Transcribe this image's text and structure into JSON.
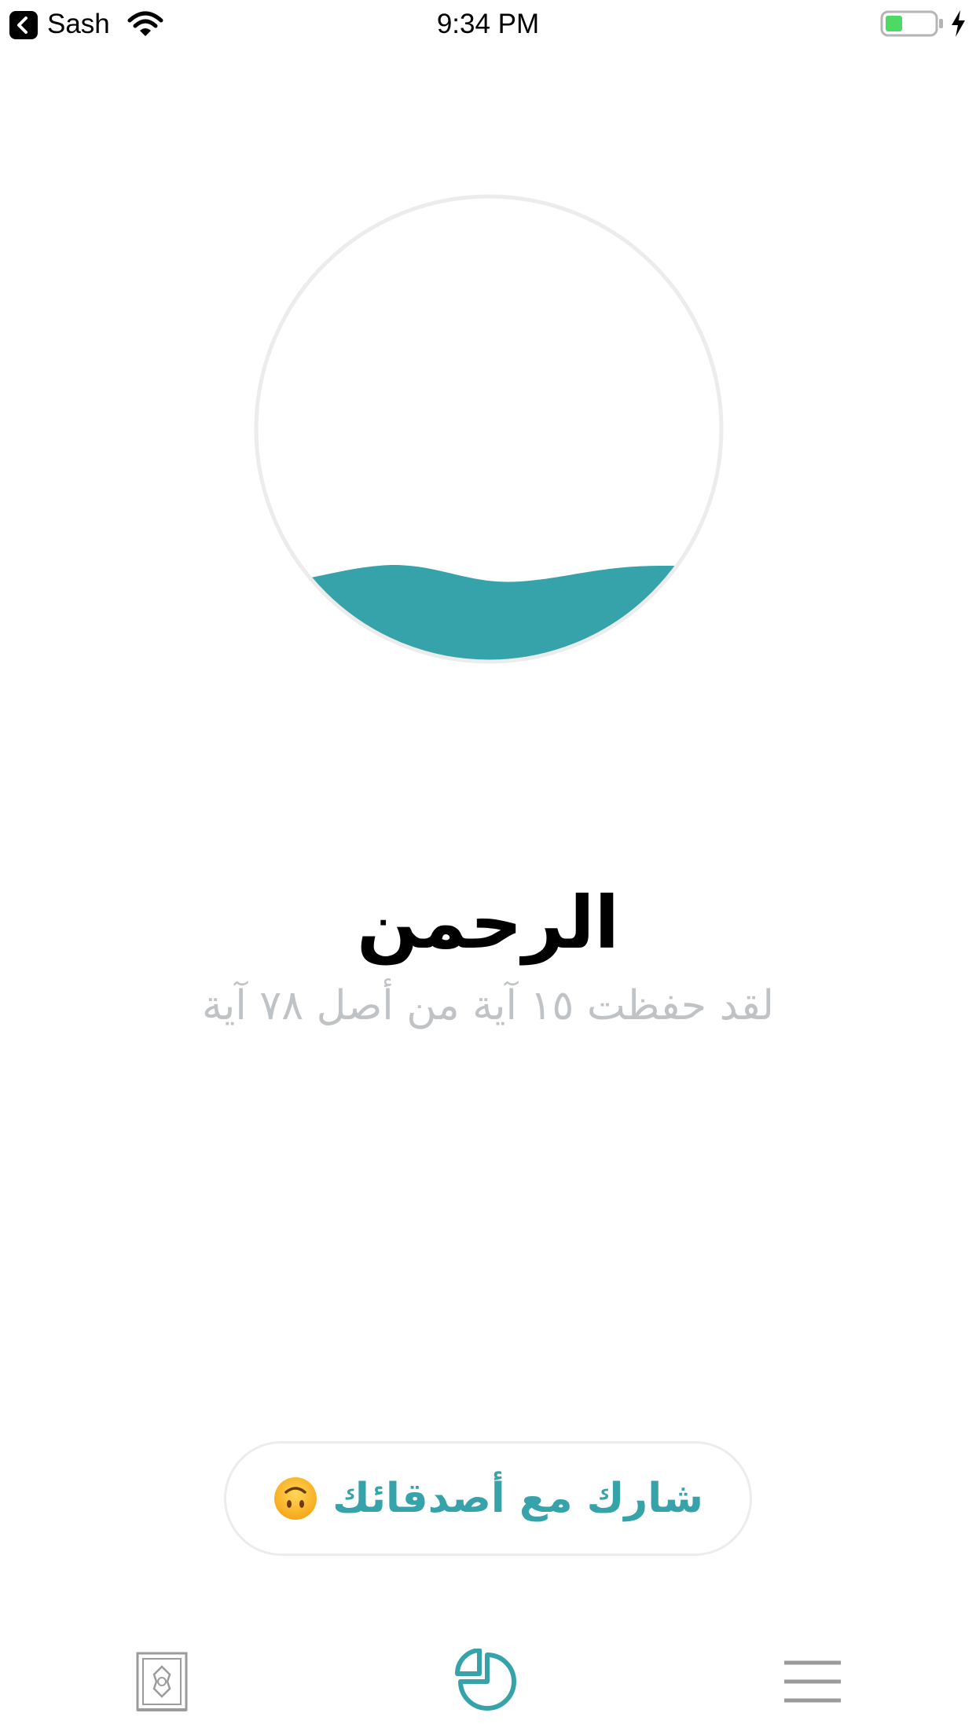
{
  "status_bar": {
    "back_app": "Sash",
    "time": "9:34 PM",
    "battery_level": 0.35
  },
  "progress": {
    "memorized": 15,
    "total": 78,
    "fraction": 0.19,
    "fill_color": "#36a3ab",
    "ring_color": "#ececec"
  },
  "surah": {
    "name": "الرحمن",
    "progress_text": "لقد حفظت ١٥ آية من أصل ٧٨ آية"
  },
  "share": {
    "label": "شارك مع أصدقائك",
    "emoji": "upside-down-face-emoji"
  },
  "tab_bar": {
    "items": [
      {
        "icon": "quran-book-icon",
        "active": false
      },
      {
        "icon": "stats-pie-icon",
        "active": true
      },
      {
        "icon": "menu-icon",
        "active": false
      }
    ],
    "active_color": "#36a3ab",
    "inactive_color": "#9b9b9b"
  }
}
